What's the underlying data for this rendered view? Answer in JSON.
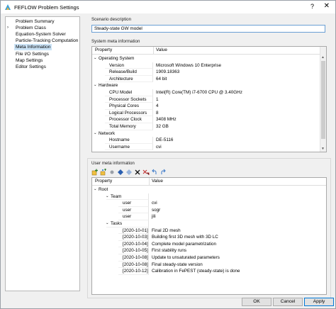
{
  "window": {
    "title": "FEFLOW Problem Settings",
    "help": "?",
    "close": "✕"
  },
  "nav": {
    "items": [
      {
        "label": "Problem Summary",
        "expander": ""
      },
      {
        "label": "Problem Class",
        "expander": "›"
      },
      {
        "label": "Equation-System Solver",
        "expander": ""
      },
      {
        "label": "Particle-Tracking Computation",
        "expander": ""
      },
      {
        "label": "Meta Information",
        "expander": "",
        "selected": true
      },
      {
        "label": "File I/O Settings",
        "expander": ""
      },
      {
        "label": "Map Settings",
        "expander": ""
      },
      {
        "label": "Editor Settings",
        "expander": ""
      }
    ]
  },
  "scenario": {
    "label": "Scenario description",
    "value": "Steady-state GW model"
  },
  "system_meta": {
    "label": "System meta information",
    "col_property": "Property",
    "col_value": "Value",
    "rows": [
      {
        "level": 0,
        "twisty": "⌄",
        "key": "Operating System",
        "value": ""
      },
      {
        "level": 1,
        "twisty": "",
        "key": "Version",
        "value": "Microsoft Windows 10 Enterprise"
      },
      {
        "level": 1,
        "twisty": "",
        "key": "Release/Build",
        "value": "1909.18363"
      },
      {
        "level": 1,
        "twisty": "",
        "key": "Architecture",
        "value": "64 bit"
      },
      {
        "level": 0,
        "twisty": "⌄",
        "key": "Hardware",
        "value": ""
      },
      {
        "level": 1,
        "twisty": "",
        "key": "CPU Model",
        "value": "Intel(R) Core(TM) i7-6700 CPU @ 3.40GHz"
      },
      {
        "level": 1,
        "twisty": "",
        "key": "Processor Sockets",
        "value": "1"
      },
      {
        "level": 1,
        "twisty": "",
        "key": "Physical Cores",
        "value": "4"
      },
      {
        "level": 1,
        "twisty": "",
        "key": "Logical Processors",
        "value": "8"
      },
      {
        "level": 1,
        "twisty": "",
        "key": "Processor Clock",
        "value": "3408 MHz"
      },
      {
        "level": 1,
        "twisty": "",
        "key": "Total Memory",
        "value": "32 GB"
      },
      {
        "level": 0,
        "twisty": "⌄",
        "key": "Network",
        "value": ""
      },
      {
        "level": 1,
        "twisty": "",
        "key": "Hostname",
        "value": "DE-5116"
      },
      {
        "level": 1,
        "twisty": "",
        "key": "Username",
        "value": "cvi"
      }
    ]
  },
  "user_meta": {
    "label": "User meta information",
    "col_property": "Property",
    "col_value": "Value",
    "toolbar_icons": [
      "add-item-icon",
      "add-child-icon",
      "edit-icon",
      "move-up-icon",
      "move-down-icon",
      "delete-icon",
      "delete-all-icon",
      "undo-icon",
      "redo-icon"
    ],
    "rows": [
      {
        "level": 0,
        "twisty": "⌄",
        "key": "Root",
        "value": ""
      },
      {
        "level": 1,
        "twisty": "⌄",
        "key": "Team",
        "value": ""
      },
      {
        "level": 2,
        "twisty": "",
        "key": "user",
        "value": "cvi"
      },
      {
        "level": 2,
        "twisty": "",
        "key": "user",
        "value": "sogr"
      },
      {
        "level": 2,
        "twisty": "",
        "key": "user",
        "value": "jili"
      },
      {
        "level": 1,
        "twisty": "⌄",
        "key": "Tasks",
        "value": ""
      },
      {
        "level": 2,
        "twisty": "",
        "key": "[2020-10-01]",
        "value": "Final 2D mesh"
      },
      {
        "level": 2,
        "twisty": "",
        "key": "[2020-10-03]",
        "value": "Building first 3D mesh with 3D LC"
      },
      {
        "level": 2,
        "twisty": "",
        "key": "[2020-10-04]",
        "value": "Complete model parametrization"
      },
      {
        "level": 2,
        "twisty": "",
        "key": "[2020-10-05]",
        "value": "First stability runs"
      },
      {
        "level": 2,
        "twisty": "",
        "key": "[2020-10-08]",
        "value": "Update to unsaturated parameters"
      },
      {
        "level": 2,
        "twisty": "",
        "key": "[2020-10-08]",
        "value": "Final steady-state version"
      },
      {
        "level": 2,
        "twisty": "",
        "key": "[2020-10-12]",
        "value": "Calibration in FePEST (steady-state) is done"
      }
    ]
  },
  "buttons": {
    "ok": "OK",
    "cancel": "Cancel",
    "apply": "Apply"
  },
  "colors": {
    "selection": "#cce4f7",
    "accent": "#0078d7"
  }
}
